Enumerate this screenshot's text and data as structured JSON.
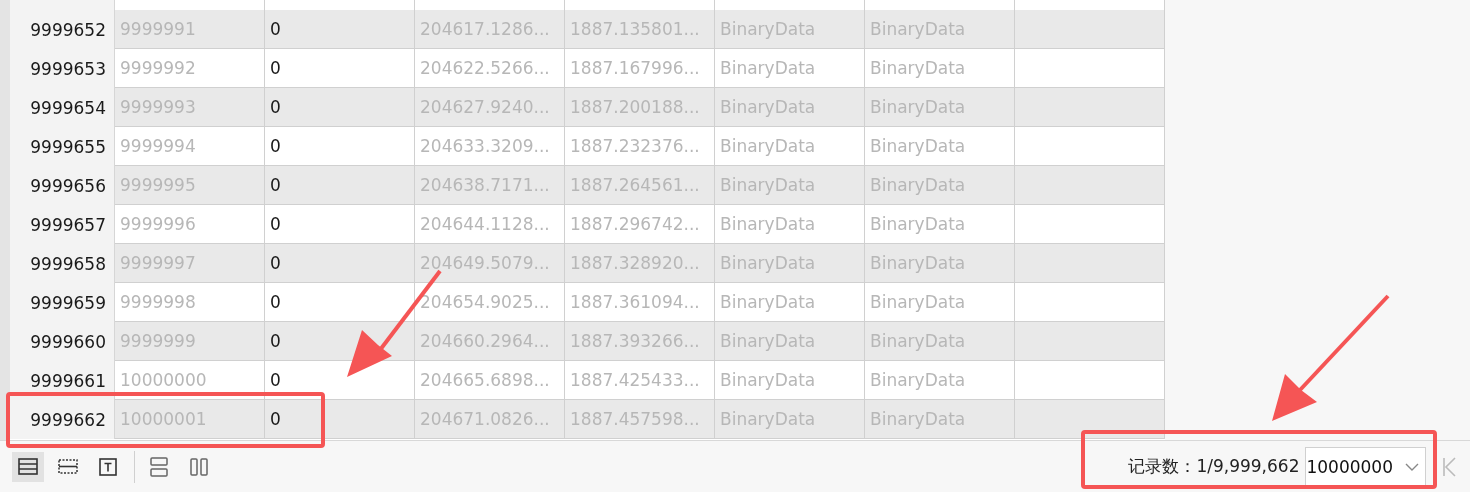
{
  "columns": [
    {
      "disabled": true
    },
    {
      "disabled": false
    },
    {
      "disabled": true
    },
    {
      "disabled": true
    },
    {
      "disabled": true
    },
    {
      "disabled": true
    }
  ],
  "rows": [
    {
      "number": "9999652",
      "cells": [
        "9999991",
        "0",
        "204617.1286...",
        "1887.135801...",
        "BinaryData",
        "BinaryData"
      ]
    },
    {
      "number": "9999653",
      "cells": [
        "9999992",
        "0",
        "204622.5266...",
        "1887.167996...",
        "BinaryData",
        "BinaryData"
      ]
    },
    {
      "number": "9999654",
      "cells": [
        "9999993",
        "0",
        "204627.9240...",
        "1887.200188...",
        "BinaryData",
        "BinaryData"
      ]
    },
    {
      "number": "9999655",
      "cells": [
        "9999994",
        "0",
        "204633.3209...",
        "1887.232376...",
        "BinaryData",
        "BinaryData"
      ]
    },
    {
      "number": "9999656",
      "cells": [
        "9999995",
        "0",
        "204638.7171...",
        "1887.264561...",
        "BinaryData",
        "BinaryData"
      ]
    },
    {
      "number": "9999657",
      "cells": [
        "9999996",
        "0",
        "204644.1128...",
        "1887.296742...",
        "BinaryData",
        "BinaryData"
      ]
    },
    {
      "number": "9999658",
      "cells": [
        "9999997",
        "0",
        "204649.5079...",
        "1887.328920...",
        "BinaryData",
        "BinaryData"
      ]
    },
    {
      "number": "9999659",
      "cells": [
        "9999998",
        "0",
        "204654.9025...",
        "1887.361094...",
        "BinaryData",
        "BinaryData"
      ]
    },
    {
      "number": "9999660",
      "cells": [
        "9999999",
        "0",
        "204660.2964...",
        "1887.393266...",
        "BinaryData",
        "BinaryData"
      ]
    },
    {
      "number": "9999661",
      "cells": [
        "10000000",
        "0",
        "204665.6898...",
        "1887.425433...",
        "BinaryData",
        "BinaryData"
      ]
    },
    {
      "number": "9999662",
      "cells": [
        "10000001",
        "0",
        "204671.0826...",
        "1887.457598...",
        "BinaryData",
        "BinaryData"
      ]
    }
  ],
  "toolbar": {
    "view_buttons": [
      {
        "kind": "grid",
        "selected": true
      },
      {
        "kind": "form",
        "selected": false
      },
      {
        "kind": "text",
        "selected": false
      }
    ],
    "layout_buttons": [
      {
        "kind": "horizontal",
        "selected": false
      },
      {
        "kind": "vertical",
        "selected": false
      }
    ]
  },
  "status": {
    "record_count": "记录数：1/9,999,662",
    "page_size": "10000000"
  }
}
